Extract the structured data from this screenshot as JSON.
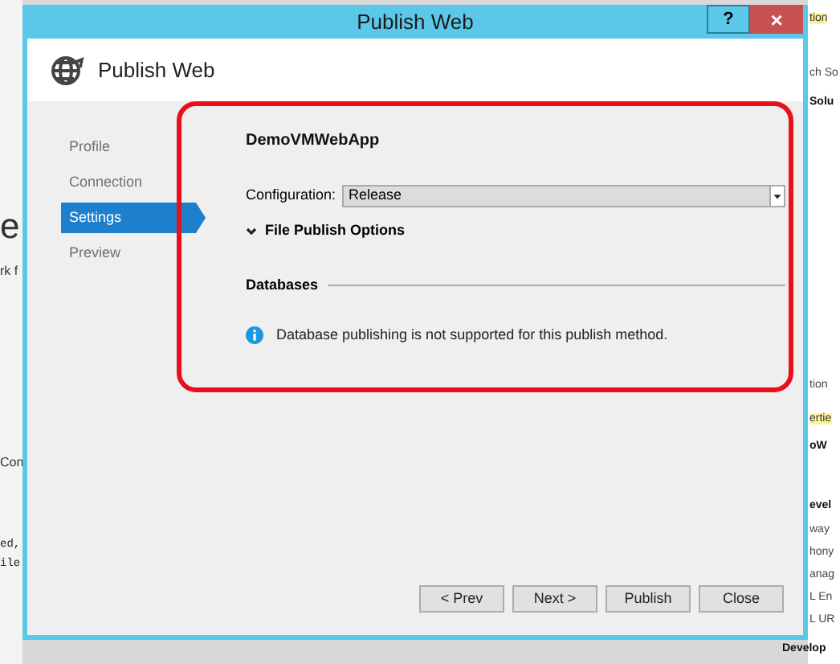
{
  "background_window_left": [
    {
      "text": "e",
      "kind": "heading"
    },
    {
      "text": "rk f",
      "kind": "text"
    },
    {
      "text": "Con",
      "kind": "text"
    },
    {
      "text": "ed,",
      "kind": "code"
    },
    {
      "text": "ile",
      "kind": "code"
    }
  ],
  "background_window_right": [
    {
      "text": "tion",
      "kind": "tab"
    },
    {
      "text": "ch So",
      "kind": "text"
    },
    {
      "text": "Solu",
      "kind": "bold"
    },
    {
      "text": "tion",
      "kind": "text"
    },
    {
      "text": "ertie",
      "kind": "tab"
    },
    {
      "text": "oW",
      "kind": "bold"
    },
    {
      "text": "evel",
      "kind": "bold"
    },
    {
      "text": "way",
      "kind": "text"
    },
    {
      "text": "hony",
      "kind": "text"
    },
    {
      "text": "anag",
      "kind": "text"
    },
    {
      "text": "L En",
      "kind": "text"
    },
    {
      "text": "L UR",
      "kind": "text"
    },
    {
      "text": "Develop",
      "kind": "bold"
    }
  ],
  "window": {
    "title": "Publish Web",
    "help_button": "?",
    "close_button": "×"
  },
  "header": {
    "title": "Publish Web"
  },
  "steps": [
    {
      "label": "Profile",
      "selected": false
    },
    {
      "label": "Connection",
      "selected": false
    },
    {
      "label": "Settings",
      "selected": true
    },
    {
      "label": "Preview",
      "selected": false
    }
  ],
  "settings": {
    "app_name": "DemoVMWebApp",
    "configuration_label": "Configuration:",
    "configuration_value": "Release",
    "file_publish_options": {
      "label": "File Publish Options",
      "expanded": false
    },
    "databases_heading": "Databases",
    "info_message": "Database publishing is not supported for this publish method."
  },
  "buttons": [
    "< Prev",
    "Next >",
    "Publish",
    "Close"
  ]
}
